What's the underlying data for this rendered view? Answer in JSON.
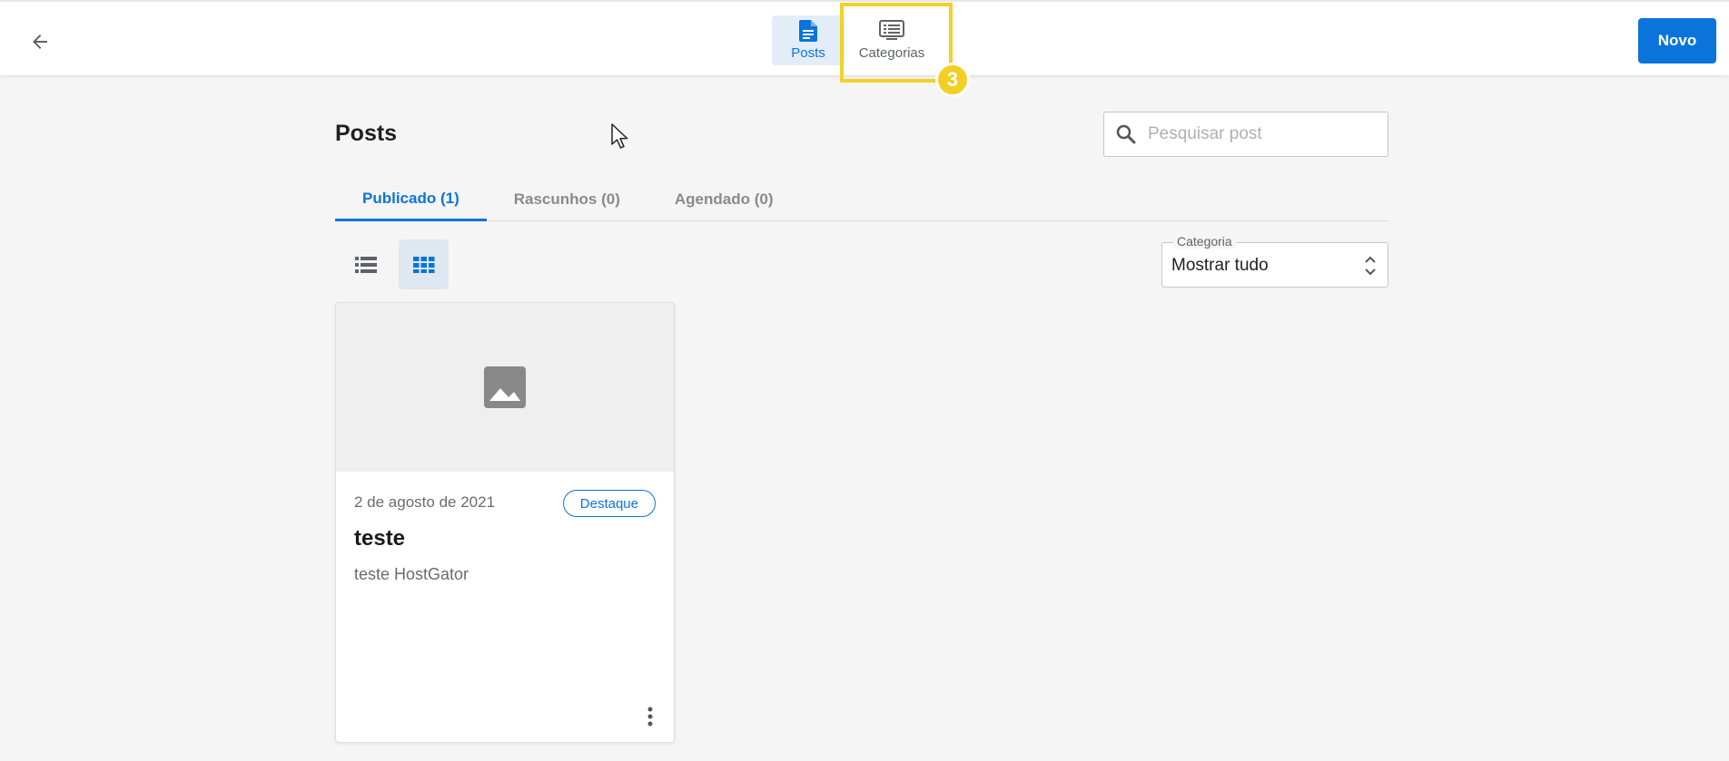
{
  "header": {
    "nav_tabs": [
      {
        "label": "Posts",
        "icon": "document-icon",
        "active": true
      },
      {
        "label": "Categorias",
        "icon": "categories-icon",
        "active": false
      }
    ],
    "step_badge": "3",
    "new_button_label": "Novo"
  },
  "main": {
    "title": "Posts",
    "search": {
      "placeholder": "Pesquisar post",
      "value": ""
    },
    "tabs": [
      {
        "label": "Publicado (1)",
        "active": true
      },
      {
        "label": "Rascunhos (0)",
        "active": false
      },
      {
        "label": "Agendado (0)",
        "active": false
      }
    ],
    "view_mode": "grid",
    "category_filter": {
      "label": "Categoria",
      "value": "Mostrar tudo"
    }
  },
  "posts": [
    {
      "date": "2 de agosto de 2021",
      "badge": "Destaque",
      "title": "teste",
      "description": "teste HostGator"
    }
  ],
  "colors": {
    "accent": "#0a74da",
    "highlight": "#f2d12a",
    "background": "#f5f5f5"
  }
}
